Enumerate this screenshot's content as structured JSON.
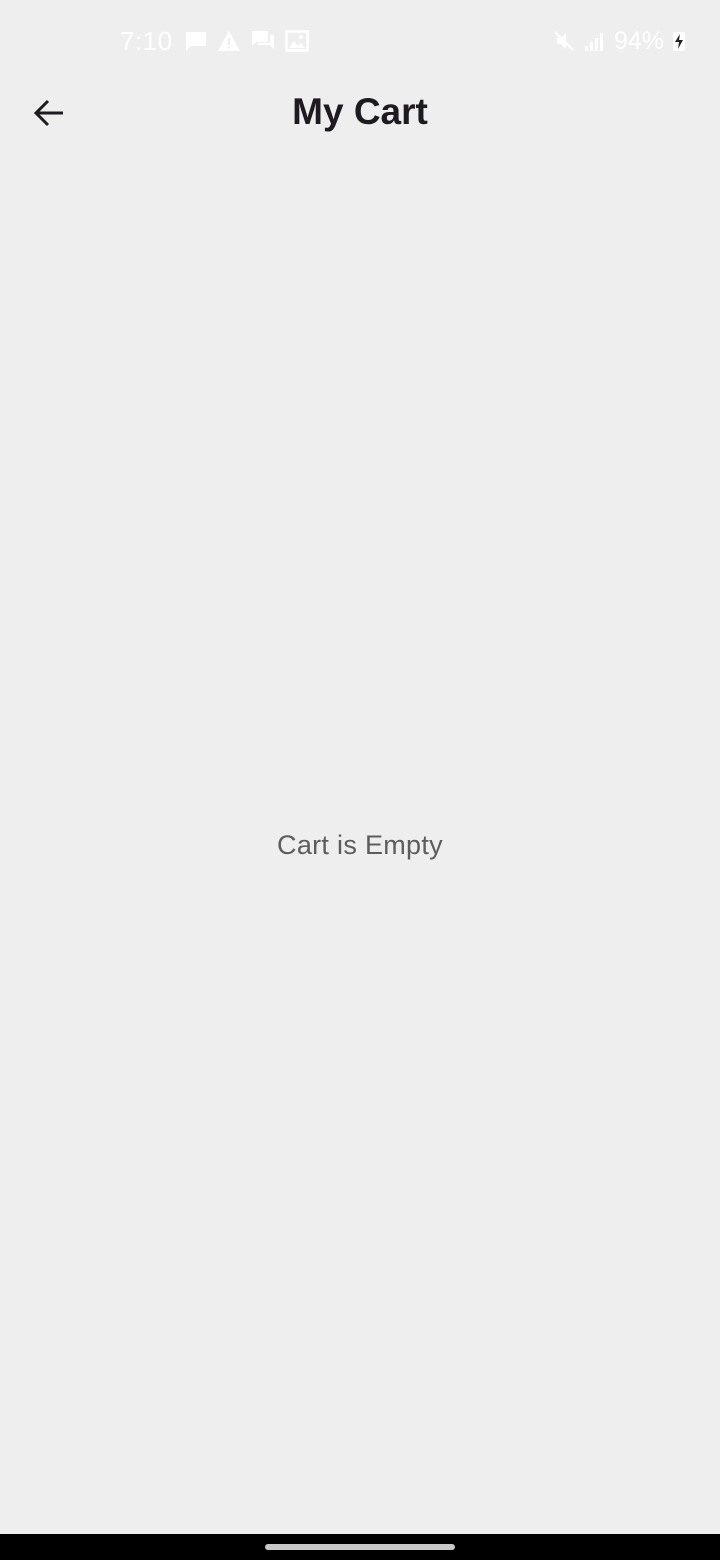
{
  "status_bar": {
    "time": "7:10",
    "battery": "94%",
    "left_icons": [
      "message-icon",
      "warning-icon",
      "chat-icon",
      "image-icon"
    ],
    "right_icons": [
      "mute-icon",
      "signal-icon",
      "charging-icon"
    ]
  },
  "header": {
    "title": "My Cart",
    "back_icon": "arrow-back-icon"
  },
  "main": {
    "empty_message": "Cart is Empty"
  },
  "colors": {
    "background": "#eeeeee",
    "title": "#1d1b20",
    "empty_text": "#5c5c5c",
    "nav_bar": "#000000"
  }
}
